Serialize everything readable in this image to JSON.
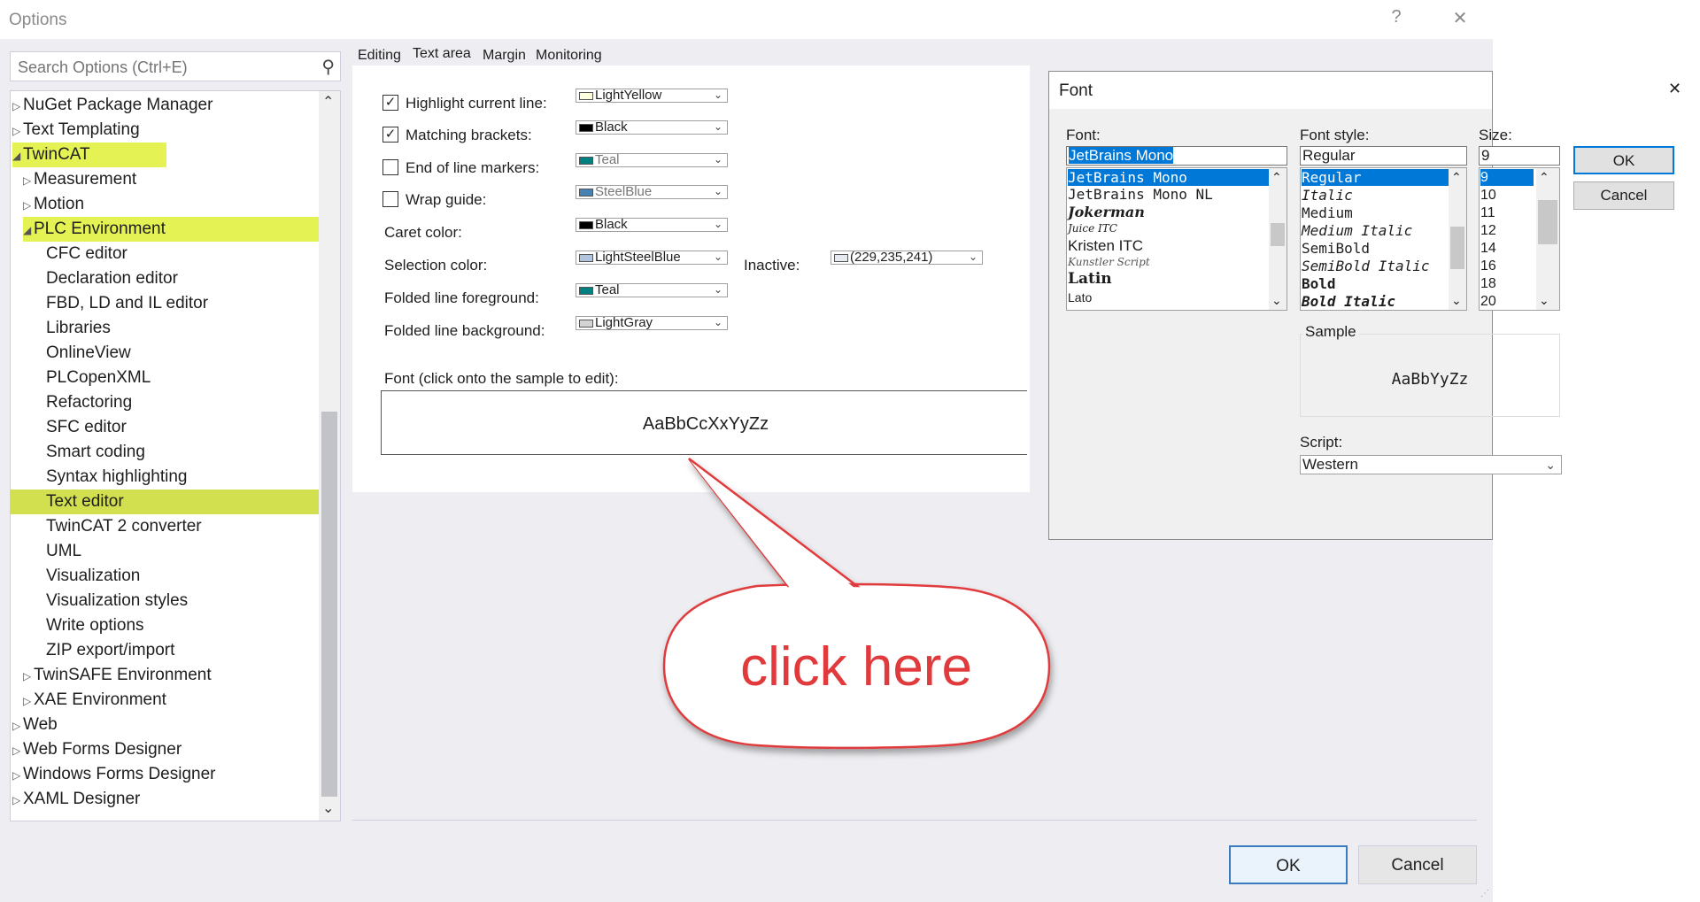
{
  "window": {
    "title": "Options",
    "help_glyph": "?",
    "close_glyph": "✕"
  },
  "search": {
    "placeholder": "Search Options (Ctrl+E)",
    "icon": "search-icon"
  },
  "tree": {
    "items": [
      {
        "label": "NuGet Package Manager",
        "arrow": "▷"
      },
      {
        "label": "Text Templating",
        "arrow": "▷"
      },
      {
        "label": "TwinCAT",
        "arrow": "◢"
      },
      {
        "label": "Measurement",
        "arrow": "▷"
      },
      {
        "label": "Motion",
        "arrow": "▷"
      },
      {
        "label": "PLC Environment",
        "arrow": "◢"
      },
      {
        "label": "CFC editor",
        "arrow": ""
      },
      {
        "label": "Declaration editor",
        "arrow": ""
      },
      {
        "label": "FBD, LD and IL editor",
        "arrow": ""
      },
      {
        "label": "Libraries",
        "arrow": ""
      },
      {
        "label": "OnlineView",
        "arrow": ""
      },
      {
        "label": "PLCopenXML",
        "arrow": ""
      },
      {
        "label": "Refactoring",
        "arrow": ""
      },
      {
        "label": "SFC editor",
        "arrow": ""
      },
      {
        "label": "Smart coding",
        "arrow": ""
      },
      {
        "label": "Syntax highlighting",
        "arrow": ""
      },
      {
        "label": "Text editor",
        "arrow": ""
      },
      {
        "label": "TwinCAT 2 converter",
        "arrow": ""
      },
      {
        "label": "UML",
        "arrow": ""
      },
      {
        "label": "Visualization",
        "arrow": ""
      },
      {
        "label": "Visualization styles",
        "arrow": ""
      },
      {
        "label": "Write options",
        "arrow": ""
      },
      {
        "label": "ZIP export/import",
        "arrow": ""
      },
      {
        "label": "TwinSAFE Environment",
        "arrow": "▷"
      },
      {
        "label": "XAE Environment",
        "arrow": "▷"
      },
      {
        "label": "Web",
        "arrow": "▷"
      },
      {
        "label": "Web Forms Designer",
        "arrow": "▷"
      },
      {
        "label": "Windows Forms Designer",
        "arrow": "▷"
      },
      {
        "label": "XAML Designer",
        "arrow": "▷"
      }
    ],
    "highlight_color": "#e5f253"
  },
  "tabs": [
    "Editing",
    "Text area",
    "Margin",
    "Monitoring"
  ],
  "text_area": {
    "highlight_current_line": {
      "label": "Highlight current line:",
      "checked": "✓",
      "value": "LightYellow",
      "swatch": "#ffffe0"
    },
    "matching_brackets": {
      "label": "Matching brackets:",
      "checked": "✓",
      "value": "Black",
      "swatch": "#000000"
    },
    "end_of_line_markers": {
      "label": "End of line markers:",
      "checked": "",
      "value": "Teal",
      "swatch": "#008080"
    },
    "wrap_guide": {
      "label": "Wrap guide:",
      "checked": "",
      "value": "SteelBlue",
      "swatch": "#4682b4"
    },
    "caret_color": {
      "label": "Caret color:",
      "value": "Black",
      "swatch": "#000000"
    },
    "selection_color": {
      "label": "Selection color:",
      "value": "LightSteelBlue",
      "swatch": "#b0c4de"
    },
    "inactive": {
      "label": "Inactive:",
      "value": "(229,235,241)",
      "swatch": "#e5ebf1"
    },
    "folded_line_foreground": {
      "label": "Folded line foreground:",
      "value": "Teal",
      "swatch": "#008080"
    },
    "folded_line_background": {
      "label": "Folded line background:",
      "value": "LightGray",
      "swatch": "#d3d3d3"
    },
    "font_label": "Font (click onto the sample to edit):",
    "font_sample": "AaBbCcXxYyZz"
  },
  "buttons": {
    "ok": "OK",
    "cancel": "Cancel"
  },
  "font_dialog": {
    "title": "Font",
    "close_glyph": "✕",
    "font_label": "Font:",
    "font_value": "JetBrains Mono",
    "fonts": [
      "JetBrains Mono",
      "JetBrains Mono NL",
      "Jokerman",
      "Juice ITC",
      "Kristen ITC",
      "Kunstler Script",
      "Latin",
      "Lato"
    ],
    "style_label": "Font style:",
    "style_value": "Regular",
    "styles": [
      "Regular",
      "Italic",
      "Medium",
      "Medium Italic",
      "SemiBold",
      "SemiBold Italic",
      "Bold",
      "Bold Italic"
    ],
    "size_label": "Size:",
    "size_value": "9",
    "sizes": [
      "9",
      "10",
      "11",
      "12",
      "14",
      "16",
      "18",
      "20"
    ],
    "ok": "OK",
    "cancel": "Cancel",
    "sample_label": "Sample",
    "sample_text": "AaBbYyZz",
    "script_label": "Script:",
    "script_value": "Western",
    "selection_color": "#0078d7"
  },
  "callout": {
    "text": "click here",
    "color": "#e03a3c"
  }
}
